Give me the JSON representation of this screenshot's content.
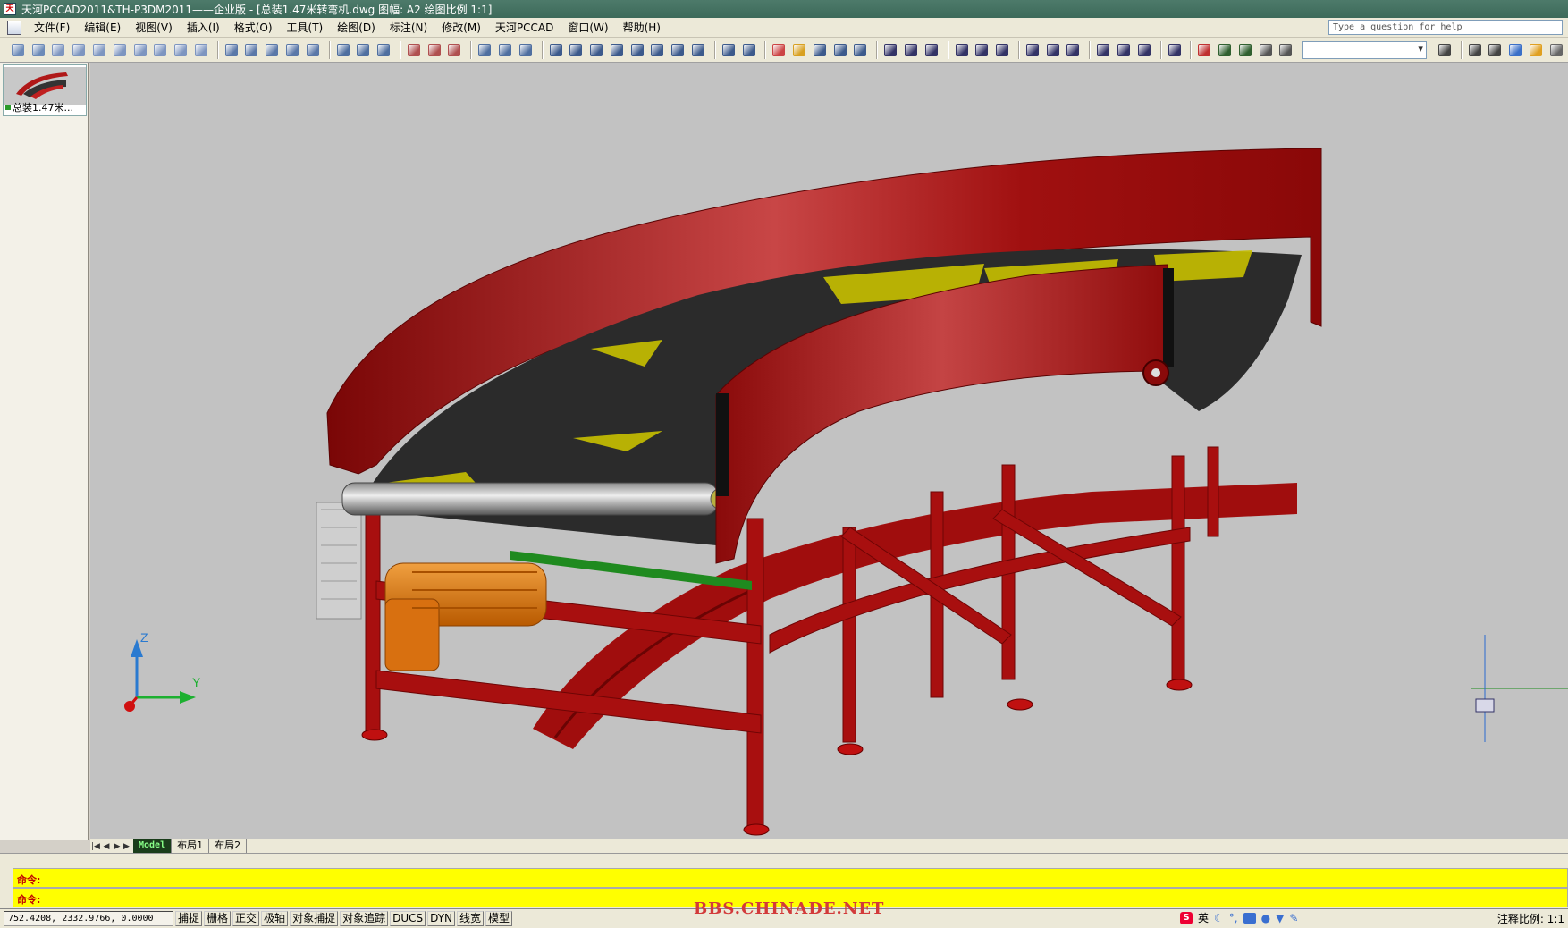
{
  "window": {
    "title": "天河PCCAD2011&TH-P3DM2011——企业版 - [总装1.47米转弯机.dwg 图幅: A2 绘图比例 1:1]"
  },
  "menubar": {
    "items": [
      "文件(F)",
      "编辑(E)",
      "视图(V)",
      "插入(I)",
      "格式(O)",
      "工具(T)",
      "绘图(D)",
      "标注(N)",
      "修改(M)",
      "天河PCCAD",
      "窗口(W)",
      "帮助(H)"
    ],
    "help_placeholder": "Type a question for help"
  },
  "toolbar": {
    "icons": [
      {
        "name": "extrude-icon",
        "color": "#6c8ab8"
      },
      {
        "name": "box-icon",
        "color": "#6c8ab8"
      },
      {
        "name": "wedge-icon",
        "color": "#7d95c0"
      },
      {
        "name": "cone-icon",
        "color": "#7d95c0"
      },
      {
        "name": "sphere-icon",
        "color": "#7d95c0"
      },
      {
        "name": "cylinder-icon",
        "color": "#7d95c0"
      },
      {
        "name": "torus-icon",
        "color": "#7d95c0"
      },
      {
        "name": "pyramid-icon",
        "color": "#7d95c0"
      },
      {
        "name": "helix-icon",
        "color": "#7d95c0"
      },
      {
        "name": "planar-surface-icon",
        "color": "#7d95c0"
      },
      {
        "sep": true
      },
      {
        "name": "extrude-face-icon",
        "color": "#5a78a8"
      },
      {
        "name": "presspull-icon",
        "color": "#5a78a8"
      },
      {
        "name": "sweep-icon",
        "color": "#5a78a8"
      },
      {
        "name": "revolve-icon",
        "color": "#5a78a8"
      },
      {
        "name": "loft-icon",
        "color": "#5a78a8"
      },
      {
        "sep": true
      },
      {
        "name": "union-icon",
        "color": "#4f6fa0"
      },
      {
        "name": "subtract-icon",
        "color": "#4f6fa0"
      },
      {
        "name": "intersect-icon",
        "color": "#4f6fa0"
      },
      {
        "sep": true
      },
      {
        "name": "3d-move-icon",
        "color": "#b05050"
      },
      {
        "name": "3d-rotate-icon",
        "color": "#b05050"
      },
      {
        "name": "3d-align-icon",
        "color": "#b05050"
      },
      {
        "sep": true
      },
      {
        "name": "union-solid-icon",
        "color": "#4f6fa0"
      },
      {
        "name": "subtract-solid-icon",
        "color": "#4f6fa0"
      },
      {
        "name": "intersect-solid-icon",
        "color": "#4f6fa0"
      },
      {
        "sep": true
      },
      {
        "name": "extrude-faces-icon",
        "color": "#3c5a8c"
      },
      {
        "name": "move-faces-icon",
        "color": "#3c5a8c"
      },
      {
        "name": "offset-faces-icon",
        "color": "#3c5a8c"
      },
      {
        "name": "delete-faces-icon",
        "color": "#3c5a8c"
      },
      {
        "name": "rotate-faces-icon",
        "color": "#3c5a8c"
      },
      {
        "name": "taper-faces-icon",
        "color": "#3c5a8c"
      },
      {
        "name": "copy-faces-icon",
        "color": "#3c5a8c"
      },
      {
        "name": "color-faces-icon",
        "color": "#3c5a8c"
      },
      {
        "sep": true
      },
      {
        "name": "imprint-icon",
        "color": "#3c5a8c"
      },
      {
        "name": "clean-icon",
        "color": "#3c5a8c"
      },
      {
        "sep": true
      },
      {
        "name": "separate-icon",
        "color": "#c44"
      },
      {
        "name": "shell-icon",
        "color": "#d8a020"
      },
      {
        "name": "check-icon",
        "color": "#3c5a8c"
      },
      {
        "name": "section-icon",
        "color": "#3c5a8c"
      },
      {
        "name": "slice-icon",
        "color": "#3c5a8c"
      },
      {
        "sep": true
      },
      {
        "name": "ucs-icon",
        "color": "#336"
      },
      {
        "name": "ucs-world-icon",
        "color": "#336"
      },
      {
        "name": "ucs-previous-icon",
        "color": "#336"
      },
      {
        "sep": true
      },
      {
        "name": "ucs-face-icon",
        "color": "#336"
      },
      {
        "name": "ucs-object-icon",
        "color": "#336"
      },
      {
        "name": "ucs-view-icon",
        "color": "#336"
      },
      {
        "sep": true
      },
      {
        "name": "ucs-origin-icon",
        "color": "#336"
      },
      {
        "name": "ucs-zaxis-icon",
        "color": "#336"
      },
      {
        "name": "ucs-3point-icon",
        "color": "#336"
      },
      {
        "sep": true
      },
      {
        "name": "ucs-x-icon",
        "color": "#336"
      },
      {
        "name": "ucs-y-icon",
        "color": "#336"
      },
      {
        "name": "ucs-z-icon",
        "color": "#336"
      },
      {
        "sep": true
      },
      {
        "name": "ucs-apply-icon",
        "color": "#336"
      },
      {
        "sep": true
      },
      {
        "name": "orbit-icon",
        "color": "#c03030"
      },
      {
        "name": "zoom-icon",
        "color": "#306030"
      },
      {
        "name": "pan-icon",
        "color": "#306030"
      },
      {
        "name": "camera-icon",
        "color": "#555"
      },
      {
        "name": "walk-icon",
        "color": "#555"
      },
      {
        "combo": true
      },
      {
        "name": "named-views-icon",
        "color": "#444"
      },
      {
        "sep": true
      },
      {
        "name": "wireframe-icon",
        "color": "#444"
      },
      {
        "name": "hidden-icon",
        "color": "#444"
      },
      {
        "name": "realistic-icon",
        "color": "#3a70c8"
      },
      {
        "name": "conceptual-icon",
        "color": "#e0a020"
      },
      {
        "name": "visual-styles-icon",
        "color": "#666"
      }
    ]
  },
  "sidebar": {
    "drawing_label": "总装1.47米..."
  },
  "tabs": {
    "items": [
      "Model",
      "布局1",
      "布局2"
    ],
    "active": "Model"
  },
  "axes": {
    "z": "Z",
    "y": "Y"
  },
  "commandline": {
    "lines": [
      "命令:",
      "命令:"
    ]
  },
  "statusbar": {
    "coords": "752.4208,  2332.9766,  0.0000",
    "toggles": [
      "捕捉",
      "栅格",
      "正交",
      "极轴",
      "对象捕捉",
      "对象追踪",
      "DUCS",
      "DYN",
      "线宽",
      "模型"
    ],
    "annotation_scale": "注释比例: 1:1"
  },
  "watermark": "BBS.CHINADE.NET",
  "ime": {
    "lang": "英"
  },
  "colors": {
    "viewport_bg": "#c2c2c2",
    "conveyor_red": "#a81010",
    "belt": "#2b2b2b",
    "motor": "#e07a10",
    "command_bg": "#ffff00"
  }
}
